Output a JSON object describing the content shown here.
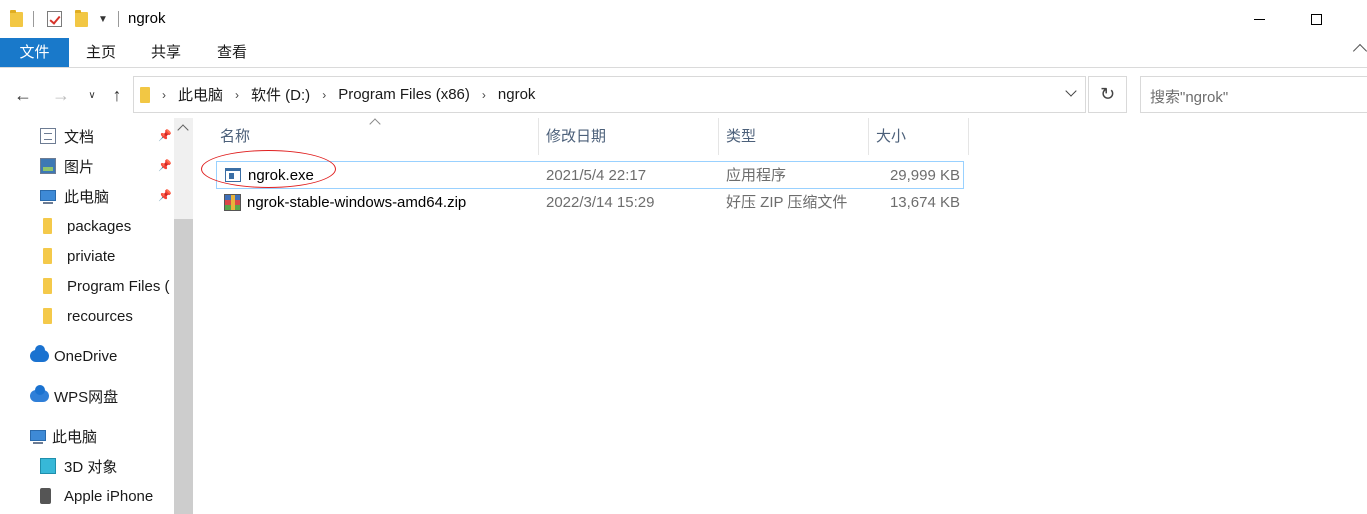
{
  "window": {
    "title": "ngrok"
  },
  "quick_access_toolbar": {
    "icons": [
      "folder-icon",
      "properties-check-icon",
      "new-folder-icon",
      "customize-dropdown-icon"
    ]
  },
  "ribbon": {
    "tabs": [
      "文件",
      "主页",
      "共享",
      "查看"
    ]
  },
  "address": {
    "breadcrumbs": [
      "此电脑",
      "软件 (D:)",
      "Program Files (x86)",
      "ngrok"
    ]
  },
  "search": {
    "placeholder": "搜索\"ngrok\""
  },
  "nav": {
    "items": [
      {
        "label": "文档",
        "icon": "documents-icon",
        "pinned": true
      },
      {
        "label": "图片",
        "icon": "pictures-icon",
        "pinned": true
      },
      {
        "label": "此电脑",
        "icon": "this-pc-icon",
        "pinned": true
      },
      {
        "label": "packages",
        "icon": "folder-icon",
        "pinned": false
      },
      {
        "label": "priviate",
        "icon": "folder-icon",
        "pinned": false
      },
      {
        "label": "Program Files (",
        "icon": "folder-icon",
        "pinned": false
      },
      {
        "label": "recources",
        "icon": "folder-icon",
        "pinned": false
      },
      {
        "label": "OneDrive",
        "icon": "onedrive-cloud-icon",
        "pinned": false
      },
      {
        "label": "WPS网盘",
        "icon": "wps-cloud-icon",
        "pinned": false
      },
      {
        "label": "此电脑",
        "icon": "this-pc-icon",
        "pinned": false
      },
      {
        "label": "3D 对象",
        "icon": "3d-objects-icon",
        "pinned": false
      },
      {
        "label": "Apple iPhone",
        "icon": "iphone-icon",
        "pinned": false
      }
    ]
  },
  "columns": {
    "name": "名称",
    "modified": "修改日期",
    "type": "类型",
    "size": "大小"
  },
  "files": [
    {
      "name": "ngrok.exe",
      "modified": "2021/5/4 22:17",
      "type": "应用程序",
      "size": "29,999 KB",
      "icon": "exe-icon",
      "selected": true,
      "annotated": true
    },
    {
      "name": "ngrok-stable-windows-amd64.zip",
      "modified": "2022/3/14 15:29",
      "type": "好压 ZIP 压缩文件",
      "size": "13,674 KB",
      "icon": "zip-archive-icon",
      "selected": false
    }
  ],
  "colors": {
    "accent": "#1979ca",
    "selection_border": "#99d1ff",
    "annotation": "#e02020"
  }
}
